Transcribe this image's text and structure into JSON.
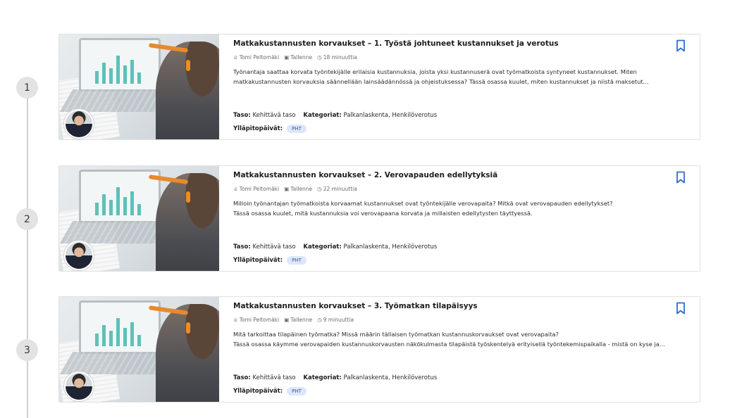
{
  "steps": [
    "1",
    "2",
    "3"
  ],
  "labels": {
    "level": "Taso:",
    "categories": "Kategoriat:",
    "maintenance": "Ylläpitopäivät:"
  },
  "icons": {
    "author": "presenter-icon",
    "format": "recording-icon",
    "duration": "clock-icon",
    "bookmark": "bookmark-icon"
  },
  "colors": {
    "accent": "#2f6dd0",
    "badge_bg": "#dce7fa"
  },
  "courses": [
    {
      "title": "Matkakustannusten korvaukset – 1. Työstä johtuneet kustannukset ja verotus",
      "author": "Tomi Peltomäki",
      "format": "Tallenne",
      "duration": "18 minuuttia",
      "desc_line1": "Työnantaja saattaa korvata työntekijälle erilaisia kustannuksia, joista yksi kustannuserä ovat työmatkoista syntyneet kustannukset. Miten",
      "desc_line2": "matkakustannusten korvauksia säännellään lainsäädännössä ja ohjeistuksessa? Tässä osassa kuulet, miten kustannukset ja niistä maksetut...",
      "level": "Kehittävä taso",
      "categories": "Palkanlaskenta,  Henkilöverotus",
      "maintenance": "PHT"
    },
    {
      "title": "Matkakustannusten korvaukset – 2. Verovapauden edellytyksiä",
      "author": "Tomi Peltomäki",
      "format": "Tallenne",
      "duration": "22 minuuttia",
      "desc_line1": "Milloin työnantajan työmatkoista korvaamat kustannukset ovat työntekijälle verovapaita? Mitkä ovat verovapauden edellytykset?",
      "desc_line2": "Tässä osassa kuulet, mitä kustannuksia voi verovapaana korvata ja millaisten edellytysten täyttyessä.",
      "level": "Kehittävä taso",
      "categories": "Palkanlaskenta,  Henkilöverotus",
      "maintenance": "PHT"
    },
    {
      "title": "Matkakustannusten korvaukset – 3. Työmatkan tilapäisyys",
      "author": "Tomi Peltomäki",
      "format": "Tallenne",
      "duration": "9 minuuttia",
      "desc_line1": "Mitä tarkoittaa tilapäinen työmatka? Missä määrin tällaisen työmatkan kustannuskorvaukset ovat verovapaita?",
      "desc_line2": "Tässä osassa käymme verovapaiden kustannuskorvausten näkökulmasta tilapäistä työskentelyä erityisellä työntekemispaikalla - mistä on kyse ja...",
      "level": "Kehittävä taso",
      "categories": "Palkanlaskenta,  Henkilöverotus",
      "maintenance": "PHT"
    }
  ]
}
